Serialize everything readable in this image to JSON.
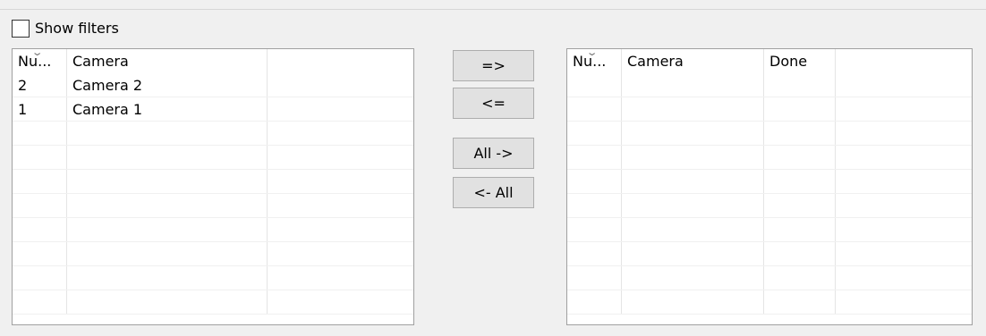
{
  "filters": {
    "show_filters_label": "Show filters",
    "checked": false
  },
  "source_list": {
    "columns": [
      "Nu...",
      "Camera",
      ""
    ],
    "rows": [
      [
        "2",
        "Camera 2",
        ""
      ],
      [
        "1",
        "Camera 1",
        ""
      ],
      [
        "",
        "",
        ""
      ],
      [
        "",
        "",
        ""
      ],
      [
        "",
        "",
        ""
      ],
      [
        "",
        "",
        ""
      ],
      [
        "",
        "",
        ""
      ],
      [
        "",
        "",
        ""
      ],
      [
        "",
        "",
        ""
      ],
      [
        "",
        "",
        ""
      ]
    ]
  },
  "buttons": {
    "add": "=>",
    "remove": "<=",
    "add_all": "All ->",
    "remove_all": "<- All"
  },
  "target_list": {
    "columns": [
      "Nu...",
      "Camera",
      "Done",
      ""
    ],
    "rows": [
      [
        "",
        "",
        "",
        ""
      ],
      [
        "",
        "",
        "",
        ""
      ],
      [
        "",
        "",
        "",
        ""
      ],
      [
        "",
        "",
        "",
        ""
      ],
      [
        "",
        "",
        "",
        ""
      ],
      [
        "",
        "",
        "",
        ""
      ],
      [
        "",
        "",
        "",
        ""
      ],
      [
        "",
        "",
        "",
        ""
      ],
      [
        "",
        "",
        "",
        ""
      ],
      [
        "",
        "",
        "",
        ""
      ]
    ]
  }
}
